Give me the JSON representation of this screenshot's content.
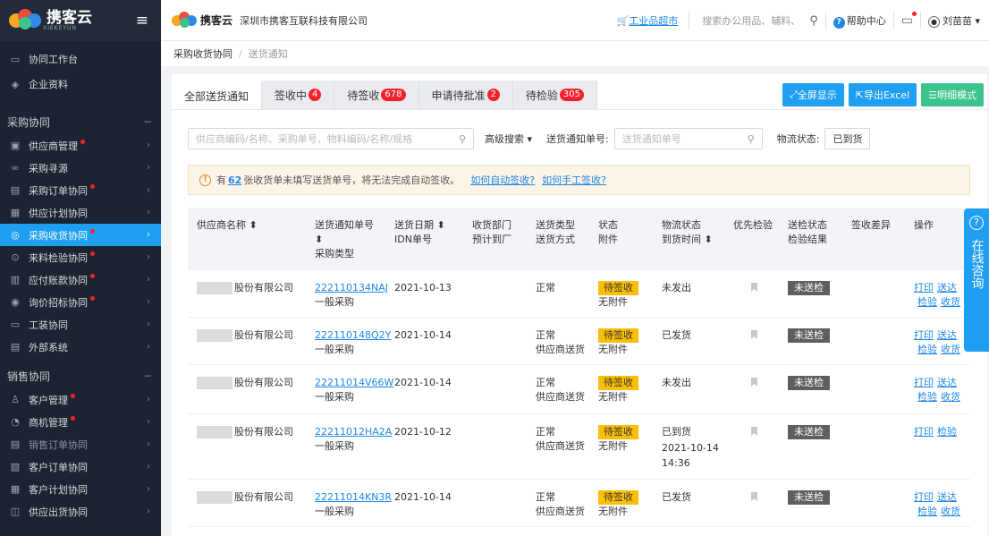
{
  "sidebar": {
    "brand": "携客云",
    "brand_sub": "XIEKEYUN",
    "top_items": [
      {
        "label": "协同工作台",
        "icon": "monitor-icon"
      },
      {
        "label": "企业资料",
        "icon": "layers-icon"
      }
    ],
    "groups": [
      {
        "title": "采购协同",
        "items": [
          {
            "label": "供应商管理",
            "dot": true,
            "icon": "vendor-icon"
          },
          {
            "label": "采购寻源",
            "dot": false,
            "icon": "binoculars-icon"
          },
          {
            "label": "采购订单协同",
            "dot": true,
            "icon": "order-icon"
          },
          {
            "label": "供应计划协同",
            "dot": false,
            "icon": "plan-icon"
          },
          {
            "label": "采购收货协同",
            "dot": true,
            "icon": "receive-icon",
            "active": true
          },
          {
            "label": "来料检验协同",
            "dot": true,
            "icon": "inspect-icon"
          },
          {
            "label": "应付账款协同",
            "dot": true,
            "icon": "payable-icon"
          },
          {
            "label": "询价招标协同",
            "dot": true,
            "icon": "bid-icon"
          },
          {
            "label": "工装协同",
            "dot": false,
            "icon": "tooling-icon"
          },
          {
            "label": "外部系统",
            "dot": false,
            "icon": "external-icon"
          }
        ]
      },
      {
        "title": "销售协同",
        "items": [
          {
            "label": "客户管理",
            "dot": true,
            "icon": "customer-icon"
          },
          {
            "label": "商机管理",
            "dot": true,
            "icon": "opportunity-icon"
          },
          {
            "label": "销售订单协同",
            "dot": false,
            "icon": "sales-order-icon",
            "dim": true
          },
          {
            "label": "客户订单协同",
            "dot": false,
            "icon": "customer-order-icon"
          },
          {
            "label": "客户计划协同",
            "dot": false,
            "icon": "customer-plan-icon"
          },
          {
            "label": "供应出货协同",
            "dot": false,
            "icon": "ship-icon"
          }
        ]
      }
    ]
  },
  "topbar": {
    "brand": "携客云",
    "company": "深圳市携客互联科技有限公司",
    "mall": "工业品超市",
    "search_placeholder": "搜索办公用品、辅料、",
    "help": "帮助中心",
    "user": "刘苗苗"
  },
  "breadcrumb": {
    "parent": "采购收货协同",
    "current": "送货通知"
  },
  "tabs": [
    {
      "label": "全部送货通知",
      "badge": "",
      "active": true
    },
    {
      "label": "签收中",
      "badge": "4"
    },
    {
      "label": "待签收",
      "badge": "678"
    },
    {
      "label": "申请待批准",
      "badge": "2"
    },
    {
      "label": "待检验",
      "badge": "305"
    }
  ],
  "actions": {
    "fullscreen": "全屏显示",
    "export": "导出Excel",
    "detail": "明细模式"
  },
  "filter": {
    "search_placeholder": "供应商编码/名称、采购单号、物料编码/名称/规格",
    "advanced": "高级搜索",
    "notice_no_label": "送货通知单号:",
    "notice_no_placeholder": "送货通知单号",
    "logistics_label": "物流状态:",
    "logistics_value": "已到货"
  },
  "notice": {
    "prefix": "有",
    "count": "62",
    "text": "张收货单未填写送货单号，将无法完成自动签收。",
    "link_auto": "如何自动签收?",
    "link_manual": "如何手工签收?"
  },
  "table": {
    "headers": {
      "supplier": "供应商名称 ⬍",
      "no_1": "送货通知单号",
      "no_2": "⬍",
      "no_3": "采购类型",
      "date_1": "送货日期 ⬍",
      "date_2": "IDN单号",
      "dept_1": "收货部门",
      "dept_2": "预计到厂",
      "type_1": "送货类型",
      "type_2": "送货方式",
      "status_1": "状态",
      "status_2": "附件",
      "logistics_1": "物流状态",
      "logistics_2": "到货时间 ⬍",
      "priority": "优先检验",
      "inspect_1": "送检状态",
      "inspect_2": "检验结果",
      "diff": "签收差异",
      "ops": "操作"
    },
    "rows": [
      {
        "supplier": "股份有限公司",
        "no": "222110134NAJ",
        "ptype": "一般采购",
        "date": "2021-10-13",
        "type": "正常",
        "method": "",
        "status": "待签收",
        "attach": "无附件",
        "logistics": "未发出",
        "arrive_date": "",
        "arrive_time": "",
        "inspect": "未送检",
        "op1": "打印",
        "op2": "送达",
        "op3": "检验",
        "op4": "收货"
      },
      {
        "supplier": "股份有限公司",
        "no": "222110148Q2Y",
        "ptype": "一般采购",
        "date": "2021-10-14",
        "type": "正常",
        "method": "供应商送货",
        "status": "待签收",
        "attach": "无附件",
        "logistics": "已发货",
        "arrive_date": "",
        "arrive_time": "",
        "inspect": "未送检",
        "op1": "打印",
        "op2": "送达",
        "op3": "检验",
        "op4": "收货"
      },
      {
        "supplier": "股份有限公司",
        "no": "22211014V66W",
        "ptype": "一般采购",
        "date": "2021-10-14",
        "type": "正常",
        "method": "供应商送货",
        "status": "待签收",
        "attach": "无附件",
        "logistics": "未发出",
        "arrive_date": "",
        "arrive_time": "",
        "inspect": "未送检",
        "op1": "打印",
        "op2": "送达",
        "op3": "检验",
        "op4": "收货"
      },
      {
        "supplier": "股份有限公司",
        "no": "22211012HA2A",
        "ptype": "一般采购",
        "date": "2021-10-12",
        "type": "正常",
        "method": "供应商送货",
        "status": "待签收",
        "attach": "无附件",
        "logistics": "已到货",
        "arrive_date": "2021-10-14",
        "arrive_time": "14:36",
        "inspect": "未送检",
        "op1": "打印",
        "op2": "检验",
        "op3": "",
        "op4": ""
      },
      {
        "supplier": "股份有限公司",
        "no": "22211014KN3R",
        "ptype": "一般采购",
        "date": "2021-10-14",
        "type": "正常",
        "method": "供应商送货",
        "status": "待签收",
        "attach": "无附件",
        "logistics": "已发货",
        "arrive_date": "",
        "arrive_time": "",
        "inspect": "未送检",
        "op1": "打印",
        "op2": "送达",
        "op3": "检验",
        "op4": "收货"
      }
    ]
  },
  "float_help": {
    "label": "在线咨询"
  },
  "colors": {
    "accent": "#1e9ff2",
    "sidebar": "#1d2431",
    "pending": "#fbbf07",
    "badge": "#f5222d"
  }
}
